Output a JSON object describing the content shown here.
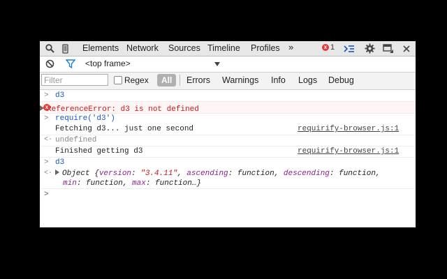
{
  "toolbar": {
    "tabs": [
      "Elements",
      "Network",
      "Sources",
      "Timeline",
      "Profiles"
    ],
    "more": "»",
    "error_count": "1",
    "error_glyph": "x",
    "icons": [
      "search-icon",
      "device-icon",
      "drawer-icon",
      "gear-icon",
      "dock-icon",
      "close-icon"
    ]
  },
  "frame": {
    "label": "<top frame>"
  },
  "filter": {
    "placeholder": "Filter",
    "regex_label": "Regex",
    "all_label": "All",
    "levels": [
      "Errors",
      "Warnings",
      "Info",
      "Logs",
      "Debug"
    ]
  },
  "console": {
    "gutter_input": ">",
    "gutter_result": "<·",
    "gutter_prompt": ">",
    "m1": "d3",
    "m2": "ReferenceError: d3 is not defined",
    "m3": "require('d3')",
    "m4_text": "Fetching d3... just one second",
    "m4_src": "requirify-browser.js:1",
    "m5": "undefined",
    "m6_text": "Finished getting d3",
    "m6_src": "requirify-browser.js:1",
    "m7": "d3",
    "obj": {
      "prefix": "Object {",
      "k1": "version",
      "v1": "\"3.4.11\"",
      "k2": "ascending",
      "k3": "descending",
      "k4": "min",
      "k5": "max",
      "fn": "function",
      "tail": "function…}"
    }
  },
  "colors": {
    "accent": "#1a55c8",
    "error": "#d0141b"
  }
}
